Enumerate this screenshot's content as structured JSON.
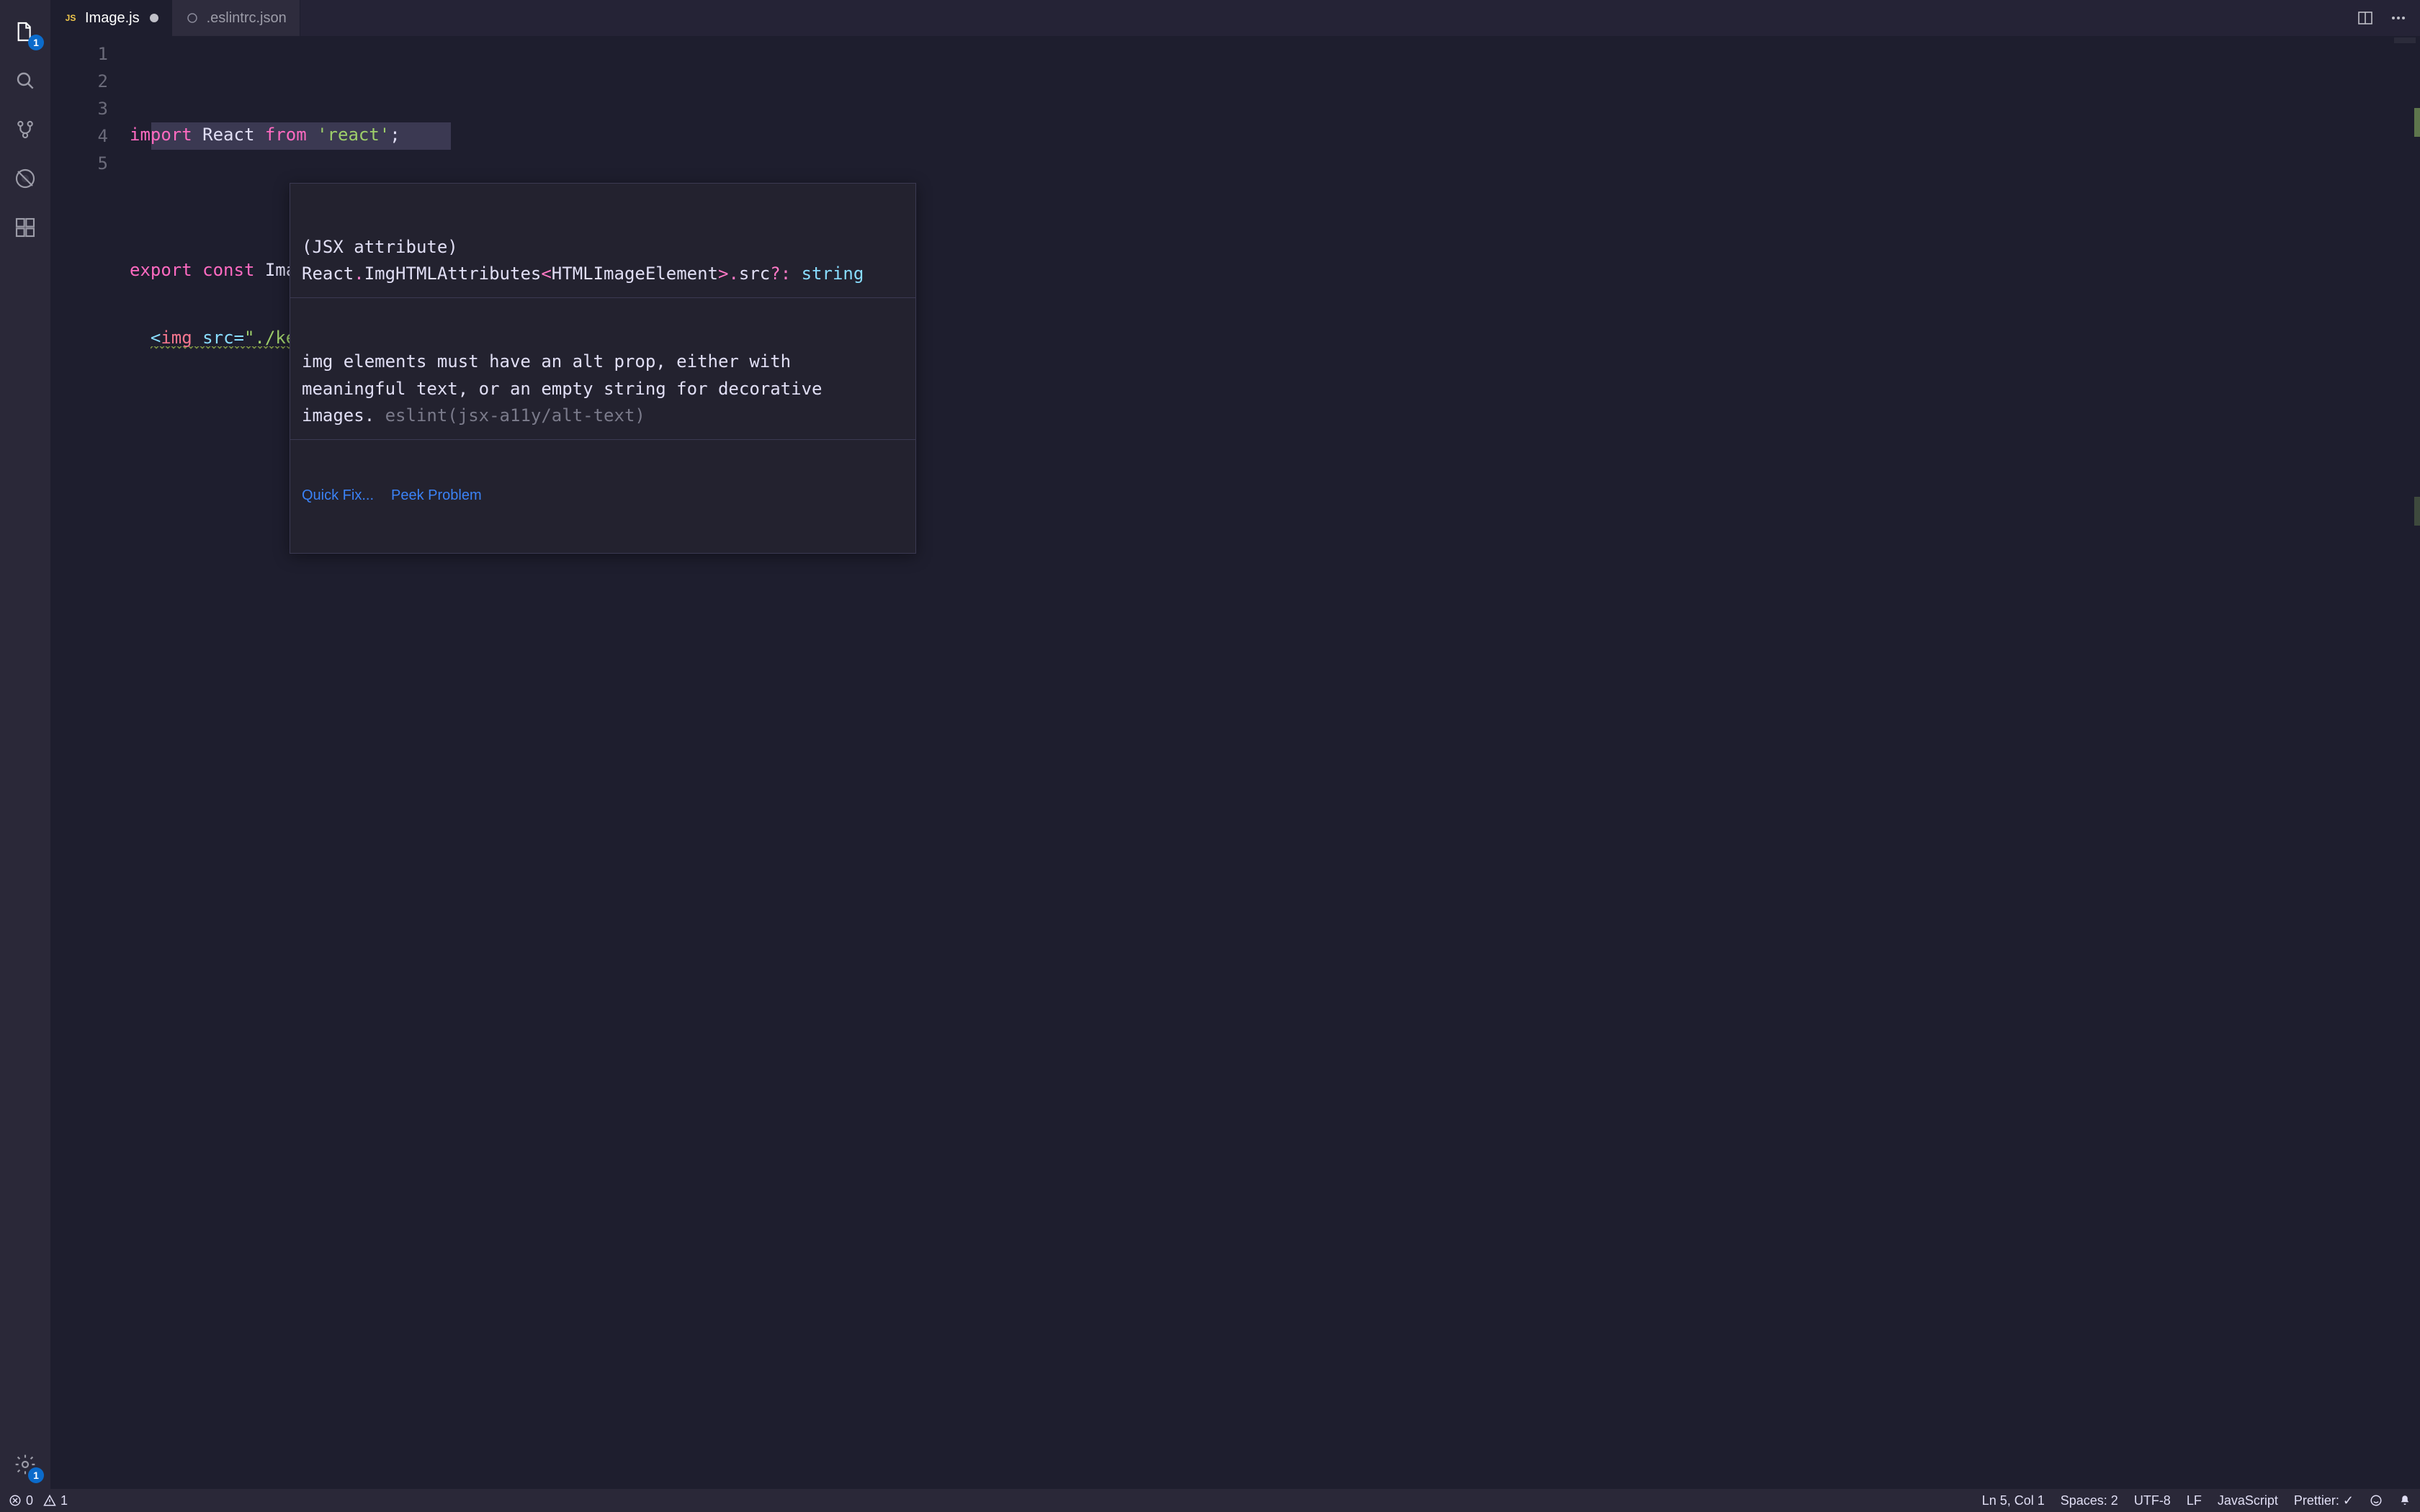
{
  "activity_bar": {
    "explorer_badge": "1",
    "settings_badge": "1"
  },
  "tabs": [
    {
      "icon_label": "JS",
      "name": "Image.js",
      "dirty": true,
      "active": true
    },
    {
      "name": ".eslintrc.json",
      "dirty": false,
      "active": false
    }
  ],
  "gutter_lines": [
    "1",
    "2",
    "3",
    "4",
    "5"
  ],
  "code": {
    "line1": {
      "import": "import",
      "ident": "React",
      "from": "from",
      "str": "'react'",
      "semi": ";"
    },
    "line3": {
      "export": "export",
      "const": "const",
      "name": "Image",
      "eq": "=",
      "parenL": "(",
      "parenR": ")",
      "arrow": "⇒"
    },
    "line4": {
      "lt": "<",
      "tag": "img",
      "attr": "src",
      "eq": "=",
      "str": "\"./ketchup.png\"",
      "slash": "/>",
      "semi": ";"
    }
  },
  "hover": {
    "sig_prefix": "(JSX attribute) ",
    "sig_ns": "React",
    "sig_dot1": ".",
    "sig_type": "ImgHTMLAttributes",
    "sig_lt": "<",
    "sig_param": "HTMLImageElement",
    "sig_gt": ">",
    "sig_dot2": ".",
    "sig_prop": "src",
    "sig_opt": "?:",
    "sig_sp": " ",
    "sig_vtype": "string",
    "message": "img elements must have an alt prop, either with meaningful text, or an empty string for decorative images.",
    "source": "eslint(jsx-a11y/alt-text)",
    "action_quickfix": "Quick Fix...",
    "action_peek": "Peek Problem"
  },
  "status": {
    "errors": "0",
    "warnings": "1",
    "cursor": "Ln 5, Col 1",
    "spaces": "Spaces: 2",
    "encoding": "UTF-8",
    "eol": "LF",
    "language": "JavaScript",
    "prettier": "Prettier: ✓"
  }
}
